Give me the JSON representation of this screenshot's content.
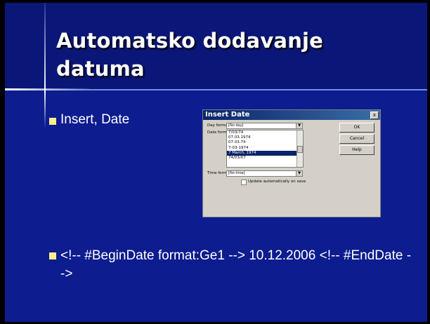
{
  "slide": {
    "title": "Automatsko dodavanje datuma",
    "bullets": [
      "Insert, Date",
      "<!-- #BeginDate format:Ge1 --> 10.12.2006 <!-- #EndDate -->"
    ]
  },
  "dialog": {
    "title": "Insert Date",
    "close_glyph": "x",
    "day_format_label": "Day format:",
    "day_format_value": "[No day]",
    "date_format_label": "Date format:",
    "date_formats": [
      "7/03/74",
      "07.03.1974",
      "07.03.74",
      "7-03-1974",
      "7 March, 1974",
      "74/03/07"
    ],
    "selected_index": 4,
    "time_format_label": "Time format:",
    "time_format_value": "[No time]",
    "update_label": "Update automatically on save",
    "ok_label": "OK",
    "cancel_label": "Cancel",
    "help_label": "Help",
    "dropdown_glyph": "▼"
  },
  "colors": {
    "slide_bg": "#0d1c8e",
    "title_band": "#0b1778",
    "bullet": "#ffef8c",
    "dialog_titlebar": "#0a246a",
    "dialog_bg": "#d4d0c8"
  }
}
